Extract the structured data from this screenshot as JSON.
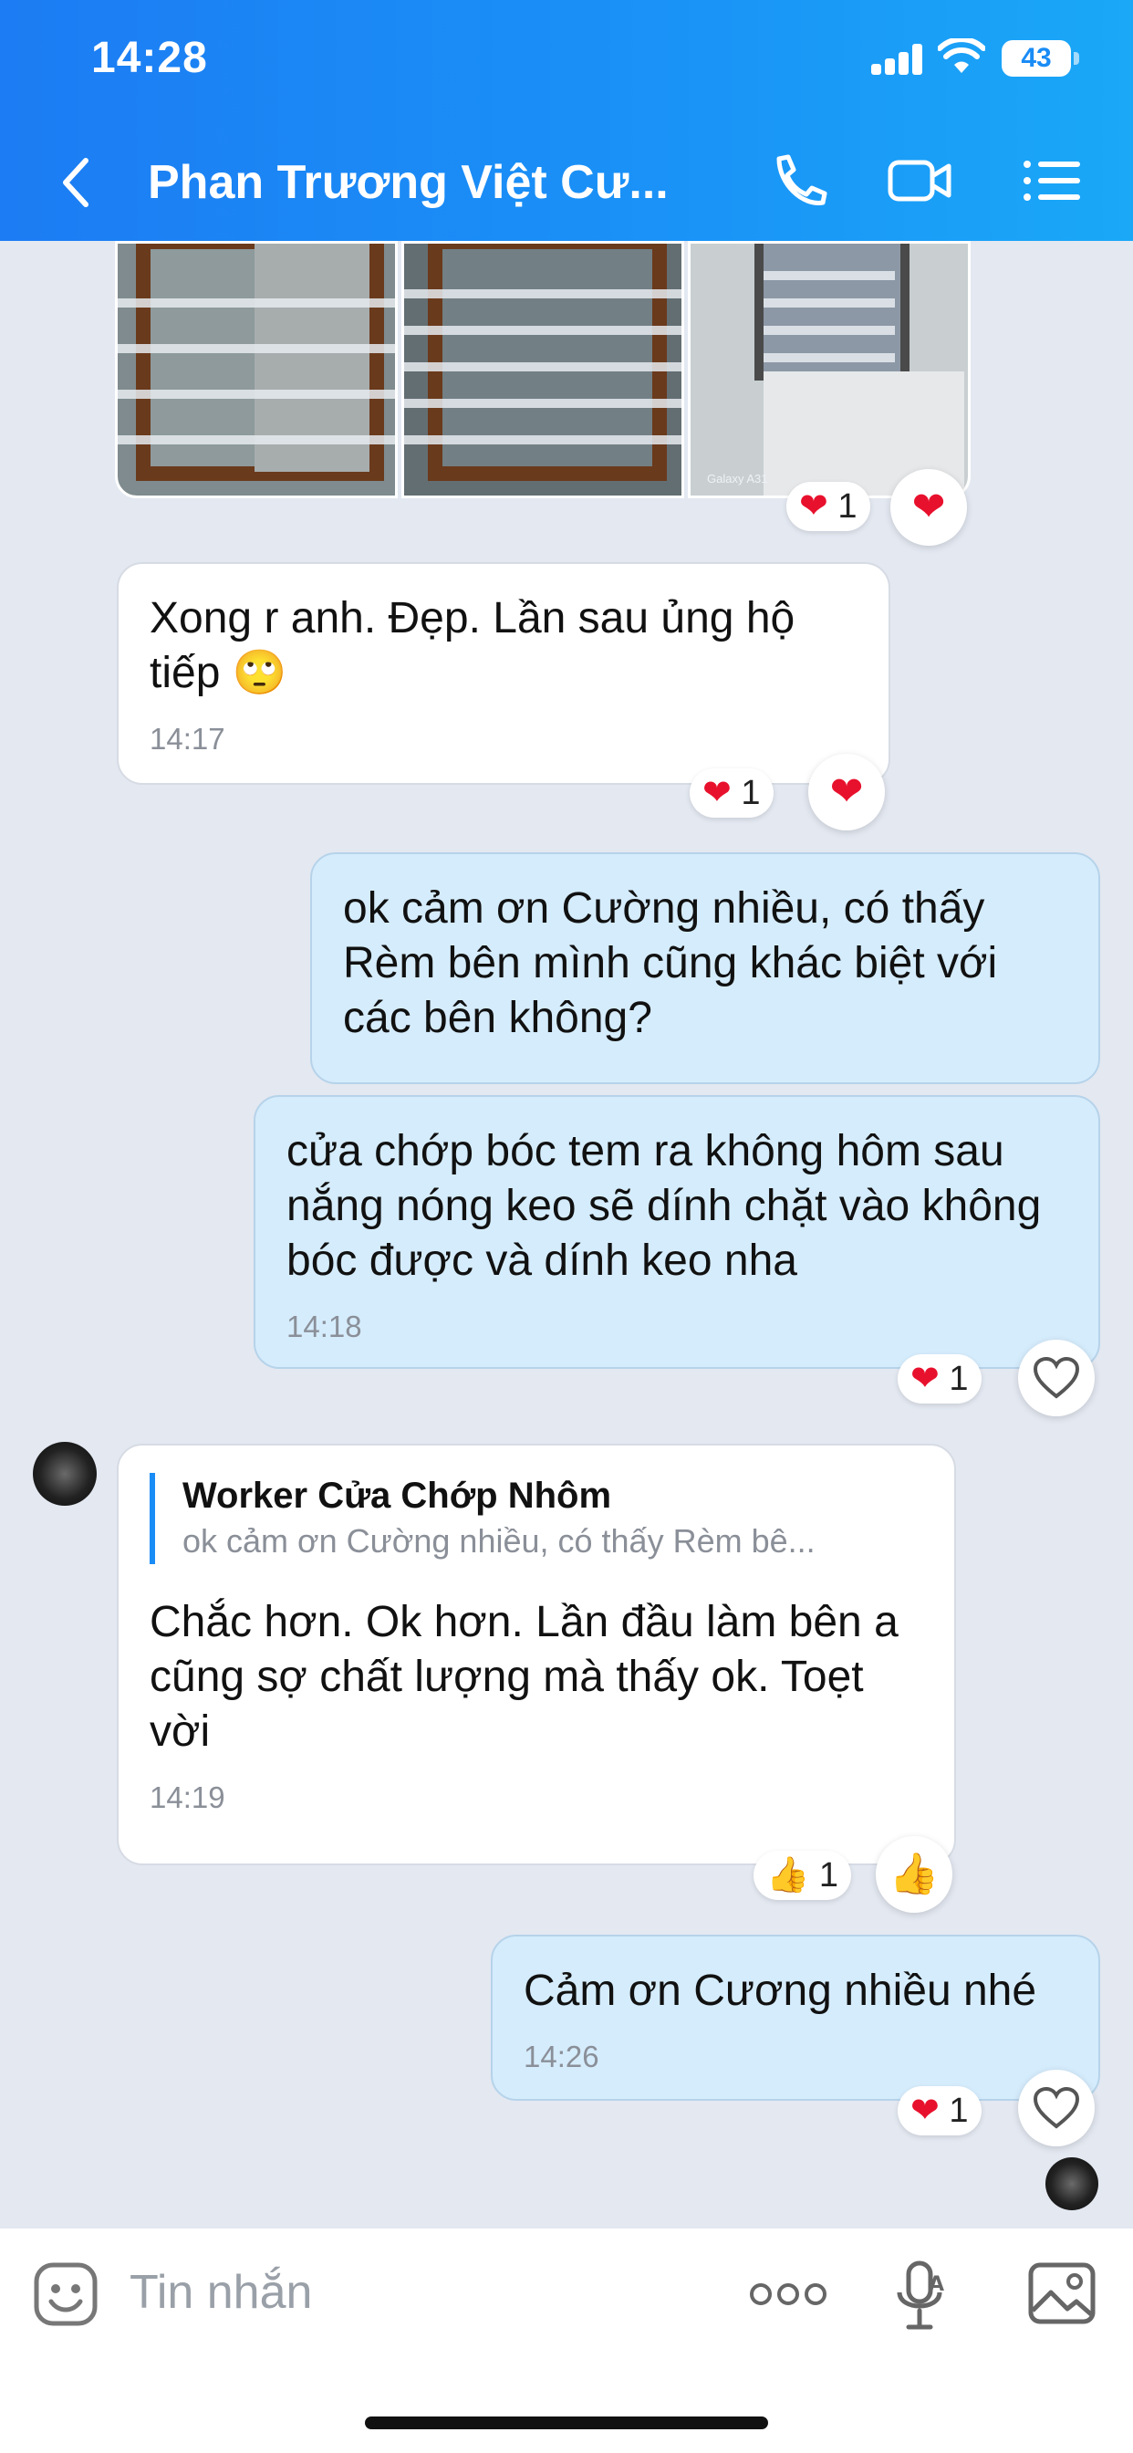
{
  "status_bar": {
    "time": "14:28",
    "battery": "43"
  },
  "header": {
    "title": "Phan Trương Việt Cư..."
  },
  "messages": [
    {
      "text": "Xong r anh. Đẹp. Lần sau ủng hộ tiếp",
      "emoji": "🙄",
      "time": "14:17",
      "reaction_count": "1"
    },
    {
      "text": "ok cảm ơn Cường nhiều, có thấy Rèm bên mình cũng khác biệt với các bên không?"
    },
    {
      "text": "cửa chớp bóc tem ra không hôm sau nắng nóng keo sẽ dính chặt vào không bóc được và dính keo nha",
      "time": "14:18",
      "reaction_count": "1"
    },
    {
      "quote_name": "Worker Cửa Chớp Nhôm",
      "quote_text": "ok cảm ơn Cường nhiều, có thấy Rèm bê...",
      "text": "Chắc hơn. Ok hơn. Lần đầu làm bên a cũng sợ chất lượng mà thấy ok. Toẹt vời",
      "time": "14:19",
      "reaction_count": "1"
    },
    {
      "text": "Cảm ơn Cương nhiều nhé",
      "time": "14:26",
      "reaction_count": "1"
    }
  ],
  "photos_reaction_count": "1",
  "photo_watermark": "Galaxy A31",
  "input": {
    "placeholder": "Tin nhắn"
  },
  "colors": {
    "header_start": "#1c7cf3",
    "header_end": "#1aa8f7",
    "chat_bg": "#e3e8f1",
    "outgoing_bubble": "#d5ecfc",
    "heart": "#e8112d"
  }
}
